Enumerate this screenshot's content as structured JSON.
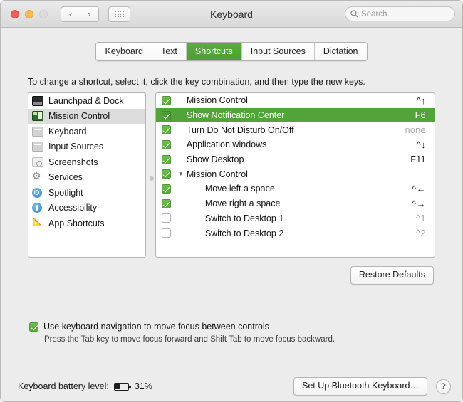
{
  "window": {
    "title": "Keyboard",
    "traffic_lights": [
      "close",
      "minimize",
      "zoom"
    ],
    "nav_back": "‹",
    "nav_forward": "›",
    "grid_button": "show-all-icon"
  },
  "search": {
    "placeholder": "Search",
    "value": "",
    "icon": "search-icon"
  },
  "tabs": [
    {
      "label": "Keyboard",
      "active": false
    },
    {
      "label": "Text",
      "active": false
    },
    {
      "label": "Shortcuts",
      "active": true
    },
    {
      "label": "Input Sources",
      "active": false
    },
    {
      "label": "Dictation",
      "active": false
    }
  ],
  "instruction": "To change a shortcut, select it, click the key combination, and then type the new keys.",
  "sidebar": {
    "items": [
      {
        "label": "Launchpad & Dock",
        "icon": "launchpad-dock-icon",
        "selected": false
      },
      {
        "label": "Mission Control",
        "icon": "mission-control-icon",
        "selected": true
      },
      {
        "label": "Keyboard",
        "icon": "keyboard-icon",
        "selected": false
      },
      {
        "label": "Input Sources",
        "icon": "input-sources-icon",
        "selected": false
      },
      {
        "label": "Screenshots",
        "icon": "screenshots-icon",
        "selected": false
      },
      {
        "label": "Services",
        "icon": "services-gear-icon",
        "selected": false
      },
      {
        "label": "Spotlight",
        "icon": "spotlight-icon",
        "selected": false
      },
      {
        "label": "Accessibility",
        "icon": "accessibility-icon",
        "selected": false
      },
      {
        "label": "App Shortcuts",
        "icon": "app-shortcuts-icon",
        "selected": false
      }
    ]
  },
  "shortcuts": {
    "rows": [
      {
        "label": "Mission Control",
        "key": "^↑",
        "checked": true,
        "selected": false,
        "indent": 0,
        "disclosure": "",
        "dim": false
      },
      {
        "label": "Show Notification Center",
        "key": "F6",
        "checked": true,
        "selected": true,
        "indent": 0,
        "disclosure": "",
        "dim": false
      },
      {
        "label": "Turn Do Not Disturb On/Off",
        "key": "none",
        "checked": true,
        "selected": false,
        "indent": 0,
        "disclosure": "",
        "dim": true
      },
      {
        "label": "Application windows",
        "key": "^↓",
        "checked": true,
        "selected": false,
        "indent": 0,
        "disclosure": "",
        "dim": false
      },
      {
        "label": "Show Desktop",
        "key": "F11",
        "checked": true,
        "selected": false,
        "indent": 0,
        "disclosure": "",
        "dim": false
      },
      {
        "label": "Mission Control",
        "key": "",
        "checked": true,
        "selected": false,
        "indent": 0,
        "disclosure": "▼",
        "dim": false
      },
      {
        "label": "Move left a space",
        "key": "^←",
        "checked": true,
        "selected": false,
        "indent": 1,
        "disclosure": "",
        "dim": false
      },
      {
        "label": "Move right a space",
        "key": "^→",
        "checked": true,
        "selected": false,
        "indent": 1,
        "disclosure": "",
        "dim": false
      },
      {
        "label": "Switch to Desktop 1",
        "key": "^1",
        "checked": false,
        "selected": false,
        "indent": 1,
        "disclosure": "",
        "dim": true
      },
      {
        "label": "Switch to Desktop 2",
        "key": "^2",
        "checked": false,
        "selected": false,
        "indent": 1,
        "disclosure": "",
        "dim": true
      }
    ]
  },
  "restore_defaults_label": "Restore Defaults",
  "keyboard_nav": {
    "checked": true,
    "label": "Use keyboard navigation to move focus between controls",
    "help": "Press the Tab key to move focus forward and Shift Tab to move focus backward."
  },
  "bottom": {
    "battery_label": "Keyboard battery level:",
    "battery_percent": "31%",
    "battery_level": 31,
    "bluetooth_button": "Set Up Bluetooth Keyboard…",
    "help_button": "?"
  },
  "colors": {
    "accent_green": "#52a33a",
    "tab_active_green": "#5aad3e",
    "window_bg": "#ececec",
    "panel_bg": "#ffffff"
  }
}
